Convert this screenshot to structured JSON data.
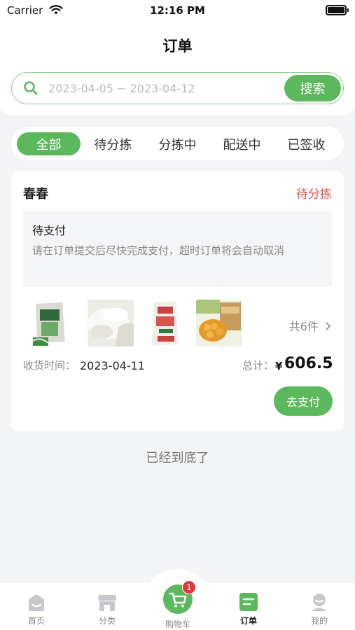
{
  "status_bar": {
    "carrier": "Carrier",
    "time": "12:16 PM"
  },
  "header": {
    "title": "订单"
  },
  "search": {
    "placeholder": "2023-04-05 ~ 2023-04-12",
    "button_label": "搜索"
  },
  "tabs": [
    {
      "label": "全部",
      "active": true
    },
    {
      "label": "待分拣",
      "active": false
    },
    {
      "label": "分拣中",
      "active": false
    },
    {
      "label": "配送中",
      "active": false
    },
    {
      "label": "已签收",
      "active": false
    }
  ],
  "order": {
    "shop_name": "春春",
    "status": "待分拣",
    "notice": {
      "title": "待支付",
      "text": "请在订单提交后尽快完成支付，超时订单将会自动取消"
    },
    "products": [
      {
        "icon": "flour-bag-image"
      },
      {
        "icon": "flour-powder-image"
      },
      {
        "icon": "flour-sack-image"
      },
      {
        "icon": "corn-box-image"
      }
    ],
    "item_count": "共6件",
    "receive_label": "收货时间：",
    "receive_date": "2023-04-11",
    "total_label": "总计：",
    "currency": "¥",
    "total": "606.5",
    "pay_button": "去支付"
  },
  "end_text": "已经到底了",
  "tabbar": {
    "items": [
      {
        "label": "首页",
        "icon": "home-icon"
      },
      {
        "label": "分类",
        "icon": "category-icon"
      },
      {
        "label": "购物车",
        "icon": "cart-icon",
        "badge": "1"
      },
      {
        "label": "订单",
        "icon": "order-icon",
        "active": true
      },
      {
        "label": "我的",
        "icon": "profile-icon"
      }
    ]
  },
  "colors": {
    "accent": "#5cb85c",
    "status_red": "#e74c4c",
    "badge_red": "#e8373b"
  }
}
